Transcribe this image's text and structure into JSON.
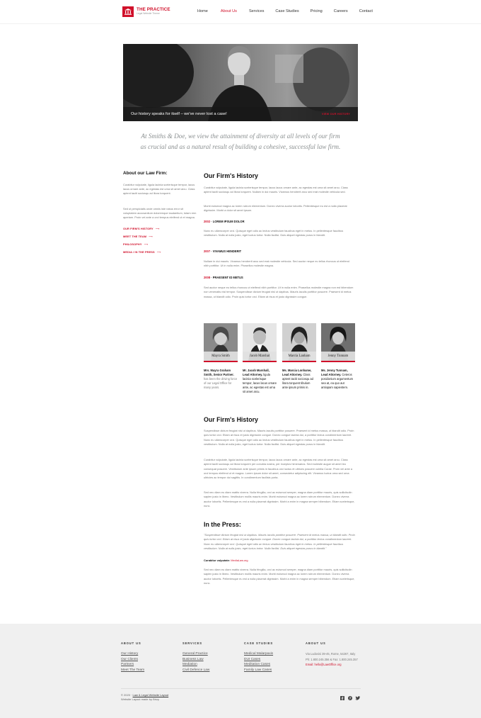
{
  "brand": {
    "name": "THE PRACTICE",
    "tagline": "Legal Website Theme"
  },
  "nav": [
    "Home",
    "About Us",
    "Services",
    "Case Studies",
    "Pricing",
    "Careers",
    "Contact"
  ],
  "active_nav": "About Us",
  "hero": {
    "caption": "Our history speaks for itself – we've never lost a case!",
    "link": "VIEW OUR HISTORY"
  },
  "quote": {
    "line1": "At Smiths & Doe, we view the attainment of diversity at all levels of our firm",
    "line2": "as crucial and as a natural result of building a cohesive, successful law firm."
  },
  "sidebar": {
    "title": "About our Law Firm:",
    "p1": "Curabitur vulputate, ligula lacinia scelerisque tempor, lacus lacus ornare ante, ac egestas est urna sit amet arcu. Class aptent taciti sociosqu ad litora torquent.",
    "p2": "Sed ut perspiciatis unde omnis iste natus error sit voluptatem accusantium doloremque laudantium, totam rem aperiam. Proin vel ante a orci tempus eleifend ut et magna.",
    "links": [
      "OUR FIRM'S HISTORY",
      "MEET THE TEAM",
      "PHILOSOPHY",
      "MEDIA / IN THE PRESS"
    ]
  },
  "history": {
    "title": "Our Firm's History",
    "p1": "Curabitur vulputate, ligula lacinia scelerisque tempor, lacus lacus ornare ante, ac egestas est urna sit amet arcu. Class aptent taciti sociosqu ad litora torquent. Nullam in dui mauris. Vivamus hendrerit arcu sed erat molestie vehicula sed.",
    "p2": "Morbi euismod magna ac lorem rutrum elementum. Donec viverra auctor lobortis. Pellentesque eu est a nulla placerat dignissim. Morbi a dolor sit amet ipsum.",
    "entries": [
      {
        "year": "2002",
        "title": "LOREM IPSUM DOLOR",
        "text": "Nunc eu ullamcorper orci. Quisque eget odio ac lectus vestibulum faucibus eget in metus. In pellentesque faucibus vestibulum. Nulla at nulla justo, eget luctus tortor. Nulla facilisi. Duis aliquet egestas purus in blandit."
      },
      {
        "year": "2007",
        "title": "VIVAMUS HENDERIT",
        "text": "Nullam in dui mauris. Vivamus hendrerit arcu sed erat molestie vehicula. Sed auctor neque eu tellus rhoncus ut eleifend nibh porttitor. Ut in nulla enim. Phasellus molestie magna."
      },
      {
        "year": "2008",
        "title": "PRAESENT ID METUS",
        "text": "Sed auctor neque eu tellus rhoncus ut eleifend nibh porttitor. Ut in nulla enim. Phasellus molestie magna non est bibendum non venenatis nisl tempor. Suspendisse dictum feugiat nisl ut dapibus. Mauris iaculis porttitor posuere. Praesent id metus massa, ut blandit odio. Proin quis tortor orci. Etiam at risus et justo dignissim congue."
      }
    ]
  },
  "team": [
    {
      "name": "Mayra Smith",
      "bold": "Mrs. Mayra Graham Smith, Senior Partner.",
      "desc": "has been the driving force of our Legal Office for many years."
    },
    {
      "name": "Jacob Marshal",
      "bold": "Mr. Jacob Marshall, Lead Attorney.",
      "desc": "ligula lacinia scelerisque tempor, lacus lacus ornare ante, ac egestas est urna sit amet arcu."
    },
    {
      "name": "Marcia Lanham",
      "bold": "Ms. Marcia Lonhame, Lead Attorney.",
      "desc": "Class aptent taciti sociosqu ad litora torquent tibulum ante ipsum primis in."
    },
    {
      "name": "Jenny Tunnam",
      "bold": "Ms. Jenny Tunnam, Lead Attorney.",
      "desc": "Ceteros posidonium argumentum sea at, ea quo aut antiopam sapientem."
    }
  ],
  "history2": {
    "title": "Our Firm's History",
    "p1": "Suspendisse dictum feugiat nisl ut dapibus. Mauris iaculis porttitor posuere. Praesent id metus massa, ut blandit odio. Proin quis tortor orci. Etiam at risus et justo dignissim congue. Donec congue lacinia dui, a porttitor lectus condimentum laoreet. Nunc eu ullamcorper orci. Quisque eget odio ac lectus vestibulum faucibus eget in metus. In pellentesque faucibus vestibulum. Nulla at nulla justo, eget luctus tortor. Nulla facilisi. Duis aliquet egestas purus in blandit.",
    "p2": "Curabitur vulputate, ligula lacinia scelerisque tempor, lacus lacus ornare ante, ac egestas est urna sit amet arcu. Class aptent taciti sociosqu ad litora torquent per conubia nostra, per inceptos himenaeos. Sed molestie augue sit amet leo consequat posuere. Vestibulum ante ipsum primis in faucibus orci luctus et ultrices posuere cubilia Curae. Proin vel ante a orci tempus eleifend ut et magna. Lorem ipsum dolor sit amet, consectetur adipiscing elit. Vivamus luctus urna sed urna ultricies ac tempor dui sagittis. In condimentum facilisis porta.",
    "p3": "Sed nec diam eu diam mattis viverra. Nulla fringilla, orci ac euismod semper, magna diam porttitor mauris, quis sollicitudin sapien justo in libero. Vestibulum mollis mauris enim. Morbi euismod magna ac lorem rutrum elementum. Donec viverra auctor lobortis. Pellentesque eu est a nulla placerat dignissim. Morbi a enim in magna semper bibendum. Etiam scelerisque, nunc."
  },
  "press": {
    "title": "In the Press:",
    "quote": "\"Suspendisse dictum feugiat nisl ut dapibus. Mauris iaculis porttitor posuere. Praesent id metus massa, ut blandit odio. Proin quis tortor orci. Etiam at risus et justo dignissim congue. Donec congue lacinia dui, a porttitor lectus condimentum laoreet. Nunc eu ullamcorper orci. Quisque eget odio ac lectus vestibulum faucibus eget in metus. In pellentesque faucibus vestibulum. Nulla at nulla justo, eget luctus tortor. Nulla facilisi. Duis aliquet egestas purus in blandit.\"",
    "source_label": "Curabitur vulputate:",
    "source_link": "MediaLaw.org",
    "p": "Sed nec diam eu diam mattis viverra. Nulla fringilla, orci ac euismod semper, magna diam porttitor mauris, quis sollicitudin sapien justo in libero. Vestibulum mollis mauris enim. Morbi euismod magna ac lorem rutrum elementum. Donec viverra auctor lobortis. Pellentesque eu est a nulla placerat dignissim. Morbi a enim in magna semper bibendum. Etiam scelerisque, nunc."
  },
  "footer": {
    "about": {
      "heading": "ABOUT US",
      "links": [
        "Our History",
        "Our Clients",
        "Partners",
        "Meet The Team"
      ]
    },
    "services": {
      "heading": "SERVICES",
      "links": [
        "General Practice",
        "Business Law",
        "Mediation",
        "Civil Defence Law"
      ]
    },
    "cases": {
      "heading": "CASE STUDIES",
      "links": [
        "Medical Malarpaxis",
        "DUI Cases",
        "Meditation Cases",
        "Family Law Cases"
      ]
    },
    "contact": {
      "heading": "ABOUT US",
      "address": "Via Ludovisi 39-45, Rome, 54267, Italy",
      "phone": "Ph: 1.800.245.356 & Fax: 1.800.245.357",
      "email": "Email: hello@LawOffice.org"
    },
    "copyright": "© 2020 ·",
    "copyright_link": "Law & Legal Website Layout",
    "credit": "Website Layout made by Brizy",
    "social": [
      "facebook-icon",
      "pinterest-icon",
      "twitter-icon"
    ]
  }
}
